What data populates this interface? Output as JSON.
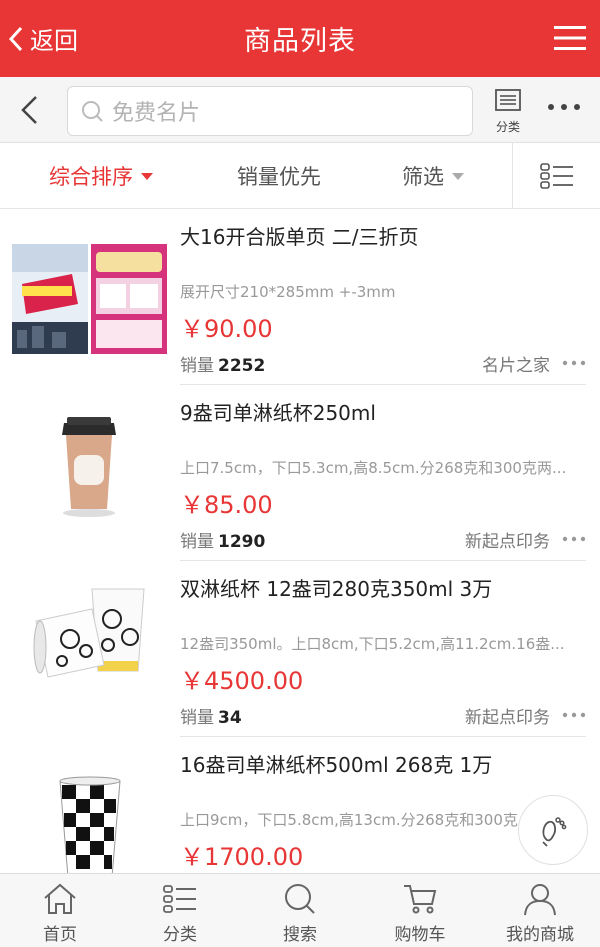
{
  "header": {
    "back_label": "返回",
    "title": "商品列表",
    "accent_color": "#e73635"
  },
  "search": {
    "placeholder": "免费名片",
    "category_label": "分类"
  },
  "sort": {
    "options": [
      "综合排序",
      "销量优先",
      "筛选"
    ],
    "active": "综合排序"
  },
  "products": [
    {
      "name": "大16开合版单页 二/三折页",
      "desc": "展开尺寸210*285mm +-3mm",
      "price": "￥90.00",
      "sales_label": "销量",
      "sales": "2252",
      "shop": "名片之家",
      "thumb_icon": "flyer-image"
    },
    {
      "name": "9盎司单淋纸杯250ml",
      "desc": "上口7.5cm，下口5.3cm,高8.5cm.分268克和300克两...",
      "price": "￥85.00",
      "sales_label": "销量",
      "sales": "1290",
      "shop": "新起点印务",
      "thumb_icon": "coffee-cup-image"
    },
    {
      "name": "双淋纸杯 12盎司280克350ml 3万",
      "desc": "12盎司350ml。上口8cm,下口5.2cm,高11.2cm.16盎...",
      "price": "￥4500.00",
      "sales_label": "销量",
      "sales": "34",
      "shop": "新起点印务",
      "thumb_icon": "paper-cups-image"
    },
    {
      "name": "16盎司单淋纸杯500ml 268克 1万",
      "desc": "上口9cm，下口5.8cm,高13cm.分268克和300克",
      "price": "￥1700.00",
      "sales_label": "销量",
      "sales": "",
      "shop": "",
      "thumb_icon": "checkered-cup-image"
    }
  ],
  "tabbar": {
    "items": [
      {
        "label": "首页",
        "icon": "home-icon"
      },
      {
        "label": "分类",
        "icon": "category-icon"
      },
      {
        "label": "搜索",
        "icon": "search-icon"
      },
      {
        "label": "购物车",
        "icon": "cart-icon"
      },
      {
        "label": "我的商城",
        "icon": "user-icon"
      }
    ]
  }
}
